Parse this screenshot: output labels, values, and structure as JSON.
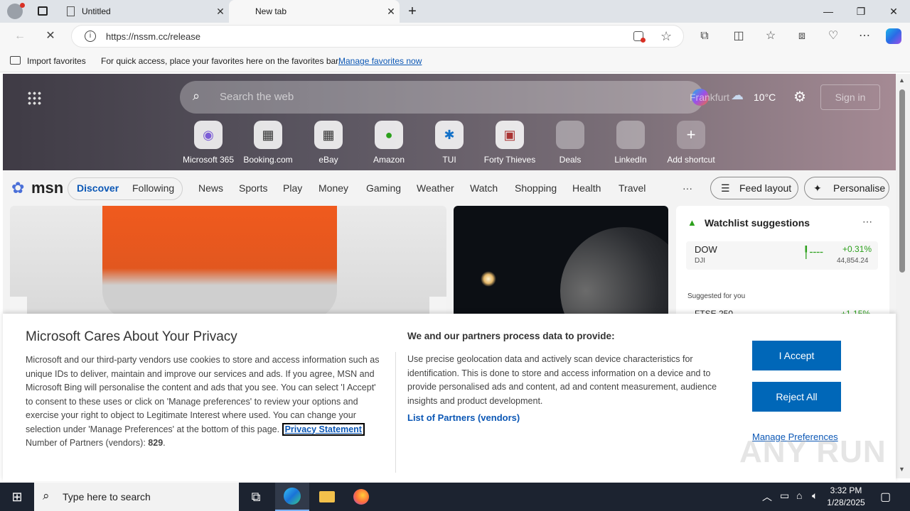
{
  "tabs": [
    {
      "title": "Untitled"
    },
    {
      "title": "New tab"
    }
  ],
  "address": {
    "url": "https://nssm.cc/release"
  },
  "favorites_bar": {
    "import_label": "Import favorites",
    "message": "For quick access, place your favorites here on the favorites bar.",
    "manage_link": "Manage favorites now"
  },
  "msn": {
    "search_placeholder": "Search the web",
    "location": "Frankfurt",
    "weather": "10°C",
    "sign_in": "Sign in",
    "shortcuts": [
      {
        "label": "Microsoft 365",
        "icon": "m365-icon"
      },
      {
        "label": "Booking.com",
        "icon": "booking-icon"
      },
      {
        "label": "eBay",
        "icon": "ebay-icon"
      },
      {
        "label": "Amazon",
        "icon": "amazon-icon"
      },
      {
        "label": "TUI",
        "icon": "tui-icon"
      },
      {
        "label": "Forty Thieves",
        "icon": "forty-thieves-icon"
      },
      {
        "label": "Deals",
        "icon": "deals-icon"
      },
      {
        "label": "LinkedIn",
        "icon": "linkedin-icon"
      },
      {
        "label": "Add shortcut",
        "icon": "plus-icon"
      }
    ],
    "logo": "msn",
    "nav": [
      "Discover",
      "Following",
      "News",
      "Sports",
      "Play",
      "Money",
      "Gaming",
      "Weather",
      "Watch",
      "Shopping",
      "Health",
      "Travel"
    ],
    "more": "···",
    "feed_layout": "Feed layout",
    "personalise": "Personalise",
    "watchlist": {
      "title": "Watchlist suggestions",
      "items": [
        {
          "symbol": "DOW",
          "sub": "DJI",
          "change": "+0.31%",
          "value": "44,854.24"
        }
      ],
      "suggested": "Suggested for you",
      "next_partial": {
        "symbol": "FTSE 250",
        "change": "+1.15%"
      }
    }
  },
  "privacy": {
    "title": "Microsoft Cares About Your Privacy",
    "body": "Microsoft and our third-party vendors use cookies to store and access information such as unique IDs to deliver, maintain and improve our services and ads. If you agree, MSN and Microsoft Bing will personalise the content and ads that you see. You can select 'I Accept' to consent to these uses or click on 'Manage preferences' to review your options and exercise your right to object to Legitimate Interest where used.  You can change your selection under 'Manage Preferences' at the bottom of this page.",
    "privacy_link": "Privacy Statement",
    "partners_label": "Number of Partners (vendors):",
    "partners_count": "829",
    "right_title": "We and our partners process data to provide:",
    "right_body": "Use precise geolocation data and actively scan device characteristics for identification. This is done to store and access information on a device and to provide personalised ads and content, ad and content measurement, audience insights and product development.",
    "partners_link": "List of Partners (vendors)",
    "accept": "I Accept",
    "reject": "Reject All",
    "manage": "Manage Preferences"
  },
  "watermark": "ANY RUN",
  "taskbar": {
    "search_placeholder": "Type here to search",
    "time": "3:32 PM",
    "date": "1/28/2025"
  },
  "colors": {
    "accent": "#0067b8",
    "link": "#0b57b5",
    "taskbar": "#1c2330"
  }
}
